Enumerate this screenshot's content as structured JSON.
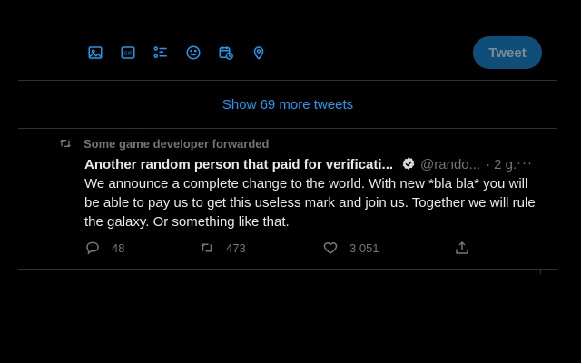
{
  "composer": {
    "tweet_label": "Tweet",
    "icons": [
      "image-icon",
      "gif-icon",
      "poll-icon",
      "emoji-icon",
      "schedule-icon",
      "location-icon"
    ]
  },
  "timeline": {
    "show_more_label": "Show 69 more tweets"
  },
  "tweet": {
    "social_context": "Some game developer forwarded",
    "author_name": "Another random person that paid for verificati...",
    "handle": "@rando...",
    "separator": "·",
    "time": "2 g.",
    "more_label": "···",
    "text": "We announce a complete change to the world. With new *bla bla* you will be able to pay us to get this useless mark and join us. Together we will rule the galaxy. Or something like that.",
    "replies": "48",
    "retweets": "473",
    "likes": "3 051"
  },
  "colors": {
    "background": "#000000",
    "accent": "#1d9bf0",
    "muted": "#71767b",
    "tweet_button_disabled": "#0f4e78"
  }
}
